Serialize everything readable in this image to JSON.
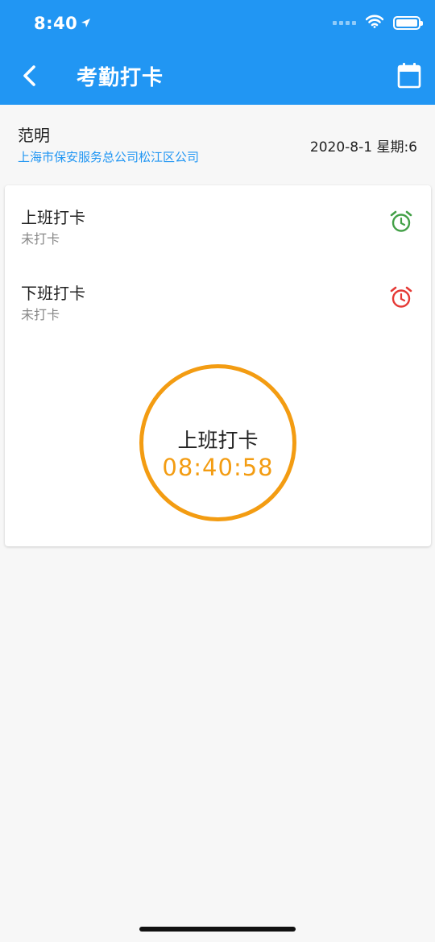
{
  "status_bar": {
    "time": "8:40"
  },
  "nav": {
    "title": "考勤打卡",
    "back_icon": "chevron-left-icon",
    "calendar_icon": "calendar-icon"
  },
  "info": {
    "user_name": "范明",
    "company": "上海市保安服务总公司松江区公司",
    "date": "2020-8-1 星期:6"
  },
  "checkins": [
    {
      "label": "上班打卡",
      "status": "未打卡",
      "icon": "alarm-clock-icon",
      "color": "#43a047"
    },
    {
      "label": "下班打卡",
      "status": "未打卡",
      "icon": "alarm-clock-icon",
      "color": "#e53935"
    }
  ],
  "punch_button": {
    "label": "上班打卡",
    "time": "08:40:58",
    "color": "#f39c12"
  },
  "colors": {
    "primary": "#2196f3",
    "accent": "#f39c12"
  }
}
